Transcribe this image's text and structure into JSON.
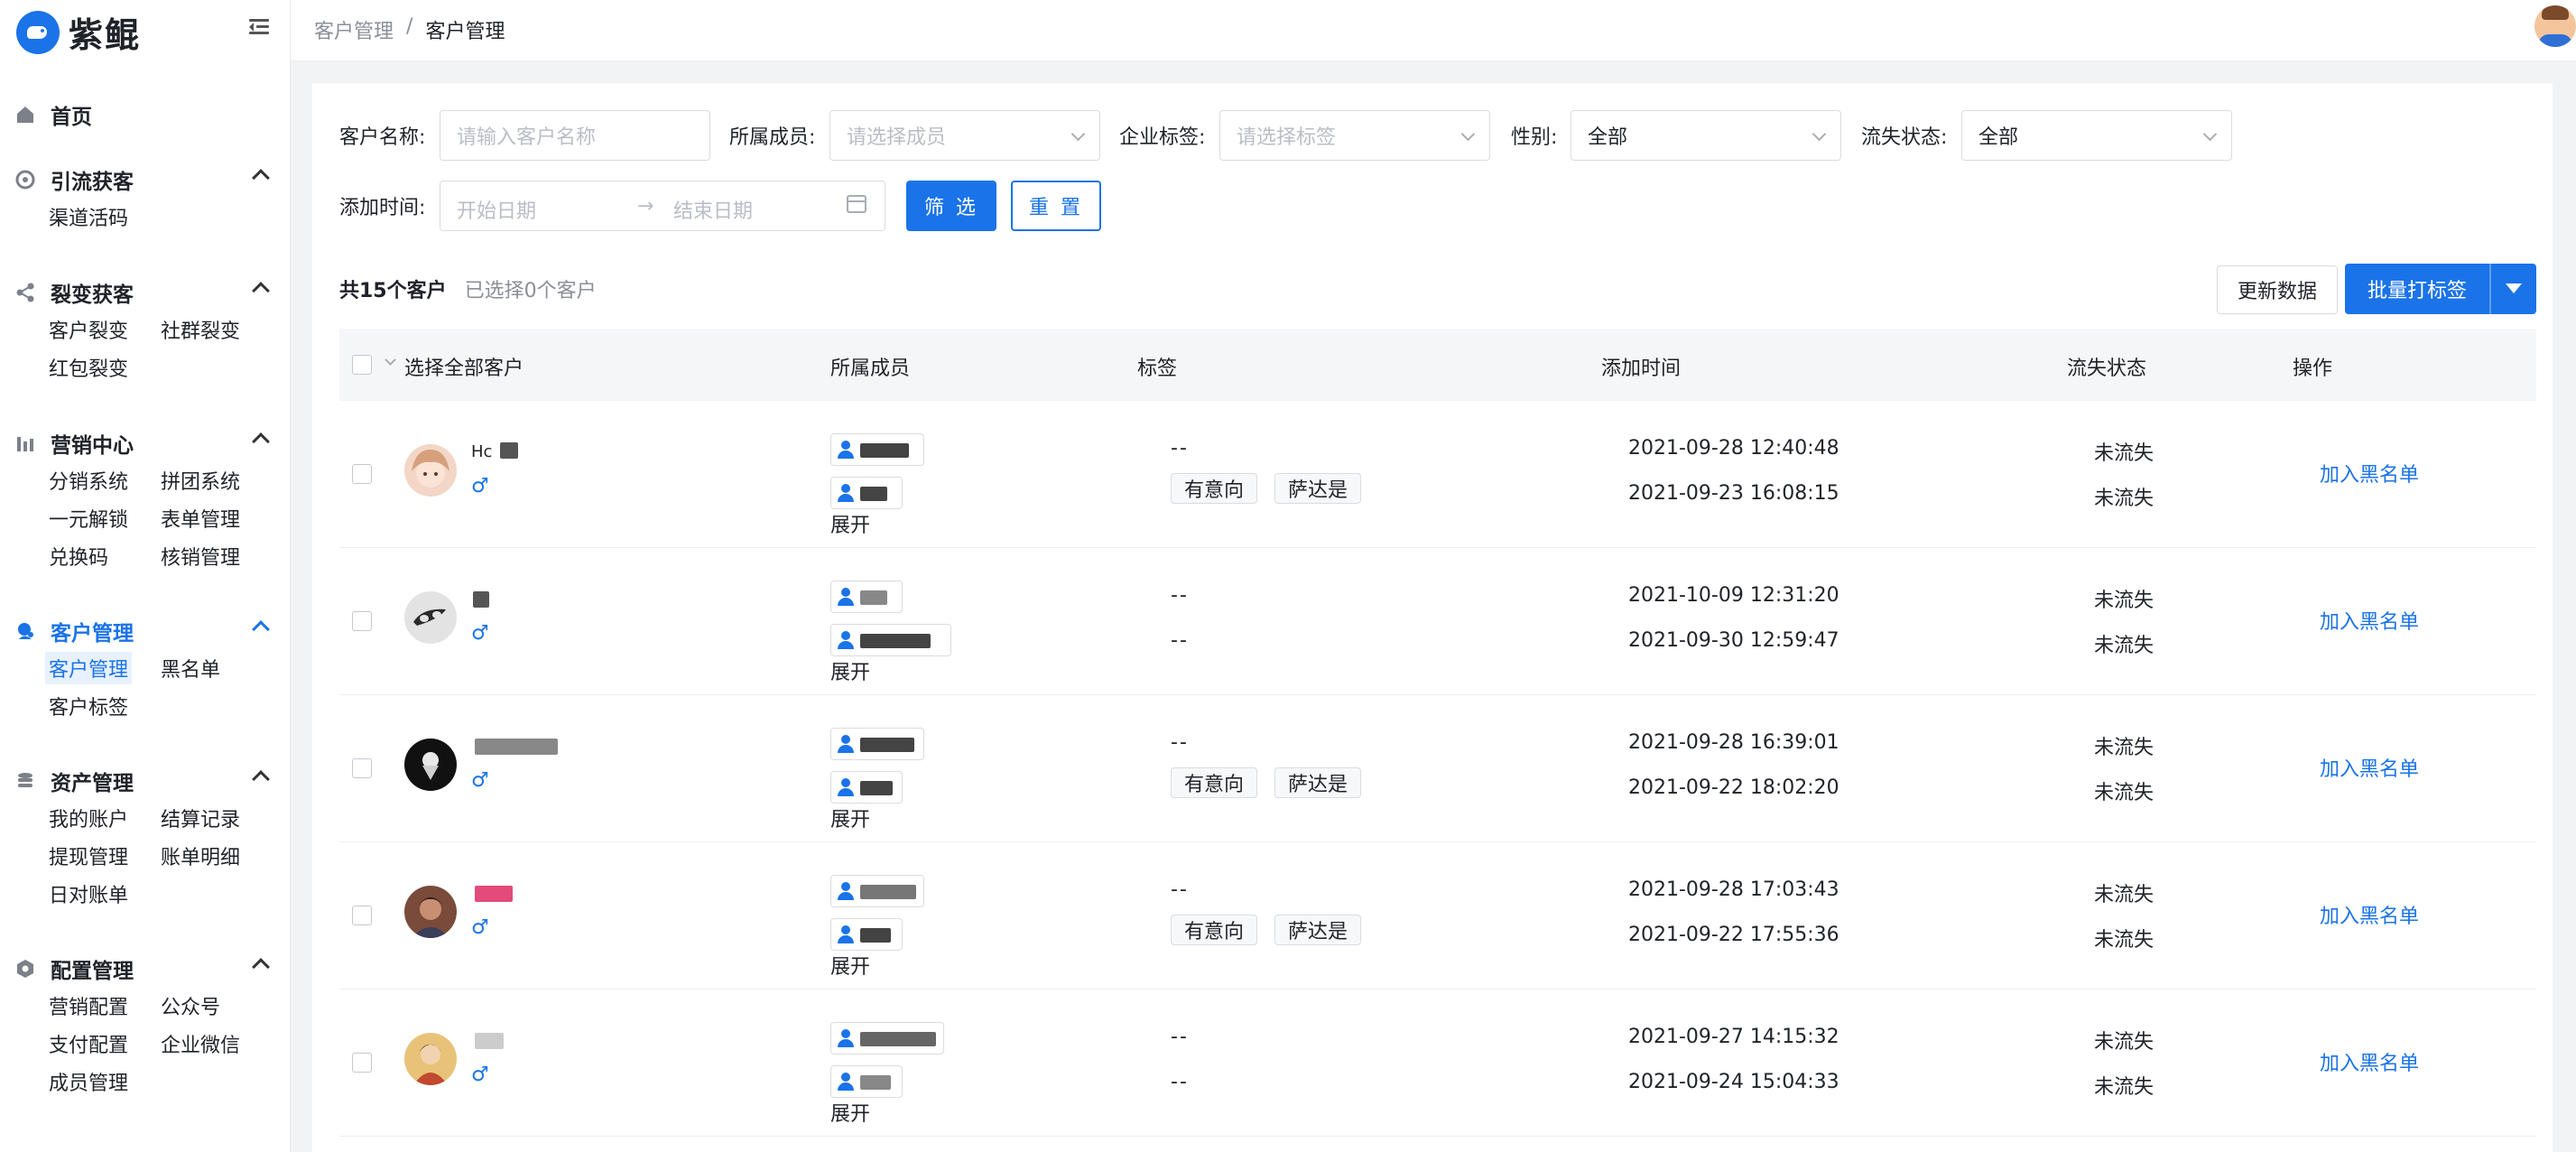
{
  "app": {
    "name": "紫鲲"
  },
  "sidebar": {
    "home": "首页",
    "groups": [
      {
        "label": "引流获客",
        "items": [
          "渠道活码"
        ]
      },
      {
        "label": "裂变获客",
        "items": [
          "客户裂变",
          "社群裂变",
          "红包裂变"
        ]
      },
      {
        "label": "营销中心",
        "items": [
          "分销系统",
          "拼团系统",
          "一元解锁",
          "表单管理",
          "兑换码",
          "核销管理"
        ]
      },
      {
        "label": "客户管理",
        "items": [
          "客户管理",
          "黑名单",
          "客户标签"
        ],
        "active_item": "客户管理"
      },
      {
        "label": "资产管理",
        "items": [
          "我的账户",
          "结算记录",
          "提现管理",
          "账单明细",
          "日对账单"
        ]
      },
      {
        "label": "配置管理",
        "items": [
          "营销配置",
          "公众号",
          "支付配置",
          "企业微信",
          "成员管理"
        ]
      }
    ]
  },
  "breadcrumb": {
    "parent": "客户管理",
    "separator": "/",
    "current": "客户管理"
  },
  "filters": {
    "customer_name": {
      "label": "客户名称:",
      "placeholder": "请输入客户名称"
    },
    "member": {
      "label": "所属成员:",
      "placeholder": "请选择成员"
    },
    "tag": {
      "label": "企业标签:",
      "placeholder": "请选择标签"
    },
    "gender": {
      "label": "性别:",
      "value": "全部"
    },
    "churn": {
      "label": "流失状态:",
      "value": "全部"
    },
    "add_time": {
      "label": "添加时间:",
      "start_placeholder": "开始日期",
      "arrow": "→",
      "end_placeholder": "结束日期"
    },
    "filter_button": "筛 选",
    "reset_button": "重 置"
  },
  "summary": {
    "total": "共15个客户",
    "selected": "已选择0个客户"
  },
  "actions": {
    "refresh": "更新数据",
    "batch_tag": "批量打标签"
  },
  "table": {
    "headers": {
      "select_all": "选择全部客户",
      "member": "所属成员",
      "tags": "标签",
      "add_time": "添加时间",
      "churn_status": "流失状态",
      "operation": "操作"
    },
    "expand_label": "展开",
    "gender_symbol": "♂",
    "action_label": "加入黑名单",
    "rows": [
      {
        "name": "Hc",
        "tags_line1": "--",
        "tags_line2": [
          "有意向",
          "萨达是"
        ],
        "times": [
          "2021-09-28 12:40:48",
          "2021-09-23 16:08:15"
        ],
        "statuses": [
          "未流失",
          "未流失"
        ]
      },
      {
        "name": "",
        "tags_line1": "--",
        "tags_line2_text": "--",
        "times": [
          "2021-10-09 12:31:20",
          "2021-09-30 12:59:47"
        ],
        "statuses": [
          "未流失",
          "未流失"
        ]
      },
      {
        "name": "",
        "tags_line1": "--",
        "tags_line2": [
          "有意向",
          "萨达是"
        ],
        "times": [
          "2021-09-28 16:39:01",
          "2021-09-22 18:02:20"
        ],
        "statuses": [
          "未流失",
          "未流失"
        ]
      },
      {
        "name": "",
        "tags_line1": "--",
        "tags_line2": [
          "有意向",
          "萨达是"
        ],
        "times": [
          "2021-09-28 17:03:43",
          "2021-09-22 17:55:36"
        ],
        "statuses": [
          "未流失",
          "未流失"
        ]
      },
      {
        "name": "",
        "tags_line1": "--",
        "tags_line2_text": "--",
        "times": [
          "2021-09-27 14:15:32",
          "2021-09-24 15:04:33"
        ],
        "statuses": [
          "未流失",
          "未流失"
        ]
      }
    ]
  },
  "colors": {
    "primary": "#1a73e8",
    "text": "#1f2329",
    "muted": "#8a8f99",
    "border": "#d9dce1"
  }
}
